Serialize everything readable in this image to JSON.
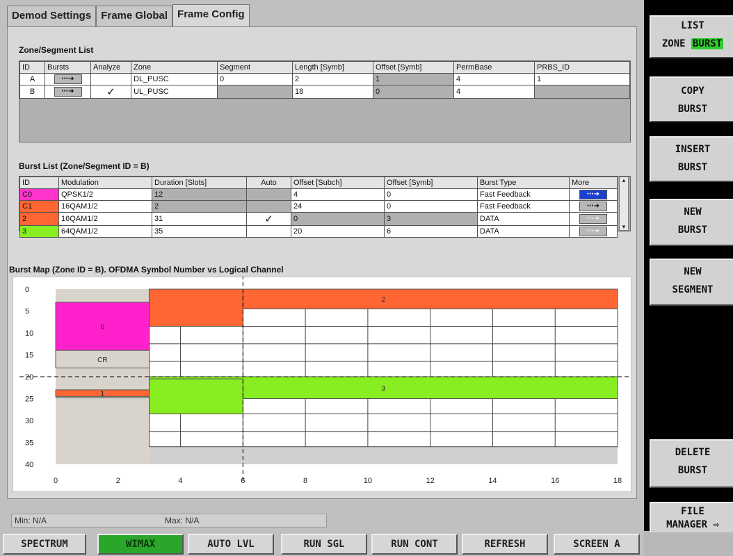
{
  "tabs": [
    "Demod Settings",
    "Frame Global",
    "Frame Config"
  ],
  "zone_list": {
    "title": "Zone/Segment List",
    "headers": [
      "ID",
      "Bursts",
      "Analyze",
      "Zone",
      "Segment",
      "Length [Symb]",
      "Offset [Symb]",
      "PermBase",
      "PRBS_ID"
    ],
    "rows": [
      {
        "id": "A",
        "analyze": "",
        "zone": "DL_PUSC",
        "segment": "0",
        "length": "2",
        "offset": "1",
        "permbase": "4",
        "prbs": "1"
      },
      {
        "id": "B",
        "analyze": "✓",
        "zone": "UL_PUSC",
        "segment": "",
        "length": "18",
        "offset": "0",
        "permbase": "4",
        "prbs": ""
      }
    ]
  },
  "burst_list": {
    "title": "Burst List (Zone/Segment ID = B)",
    "headers": [
      "ID",
      "Modulation",
      "Duration [Slots]",
      "Auto",
      "Offset [Subch]",
      "Offset [Symb]",
      "Burst Type",
      "More"
    ],
    "rows": [
      {
        "id": "C0",
        "color": "#ff33cc",
        "mod": "QPSK1/2",
        "dur": "12",
        "auto": "",
        "osub": "4",
        "osym": "0",
        "type": "Fast Feedback"
      },
      {
        "id": "C1",
        "color": "#ff6633",
        "mod": "16QAM1/2",
        "dur": "2",
        "auto": "",
        "osub": "24",
        "osym": "0",
        "type": "Fast Feedback"
      },
      {
        "id": "2",
        "color": "#ff6633",
        "mod": "16QAM1/2",
        "dur": "31",
        "auto": "✓",
        "osub": "0",
        "osym": "3",
        "type": "DATA"
      },
      {
        "id": "3",
        "color": "#88ee22",
        "mod": "64QAM1/2",
        "dur": "35",
        "auto": "",
        "osub": "20",
        "osym": "6",
        "type": "DATA"
      }
    ]
  },
  "burst_map": {
    "title": "Burst Map (Zone ID = B). OFDMA Symbol Number vs Logical Channel",
    "y_ticks": [
      "0",
      "5",
      "10",
      "15",
      "20",
      "25",
      "30",
      "35",
      "40"
    ],
    "x_ticks": [
      "0",
      "2",
      "4",
      "6",
      "8",
      "10",
      "12",
      "14",
      "16",
      "18"
    ],
    "bursts": [
      {
        "label": "2",
        "x0": 3,
        "x1": 18,
        "y0": 0,
        "y1": 4.5,
        "color": "#ff6633"
      },
      {
        "label": "0",
        "x0": 0,
        "x1": 3,
        "y0": 3,
        "y1": 14,
        "color": "#ff22cc"
      },
      {
        "label": "CR",
        "x0": 0,
        "x1": 3,
        "y0": 14,
        "y1": 18,
        "color": "#d8d4cc"
      },
      {
        "label": "1",
        "x0": 0,
        "x1": 3,
        "y0": 23,
        "y1": 24.5,
        "color": "#ff6633"
      },
      {
        "label": "3",
        "x0": 3,
        "x1": 18,
        "y0": 20,
        "y1": 25,
        "color": "#88ee22"
      }
    ]
  },
  "status": {
    "min": "Min: N/A",
    "max": "Max: N/A"
  },
  "softkeys": [
    {
      "l1": "LIST",
      "l2a": "ZONE ",
      "l2b": "BURST"
    },
    {
      "l1": "COPY",
      "l2": "BURST"
    },
    {
      "l1": "INSERT",
      "l2": "BURST"
    },
    {
      "l1": "NEW",
      "l2": "BURST"
    },
    {
      "l1": "NEW",
      "l2": "SEGMENT"
    },
    {
      "l1": "DELETE",
      "l2": "BURST"
    },
    {
      "l1": "FILE",
      "l2": "MANAGER ⇨"
    }
  ],
  "bottom_keys": [
    "SPECTRUM",
    "WIMAX",
    "AUTO LVL",
    "RUN SGL",
    "RUN CONT",
    "REFRESH",
    "SCREEN A"
  ],
  "more_glyph": "⋯➜"
}
